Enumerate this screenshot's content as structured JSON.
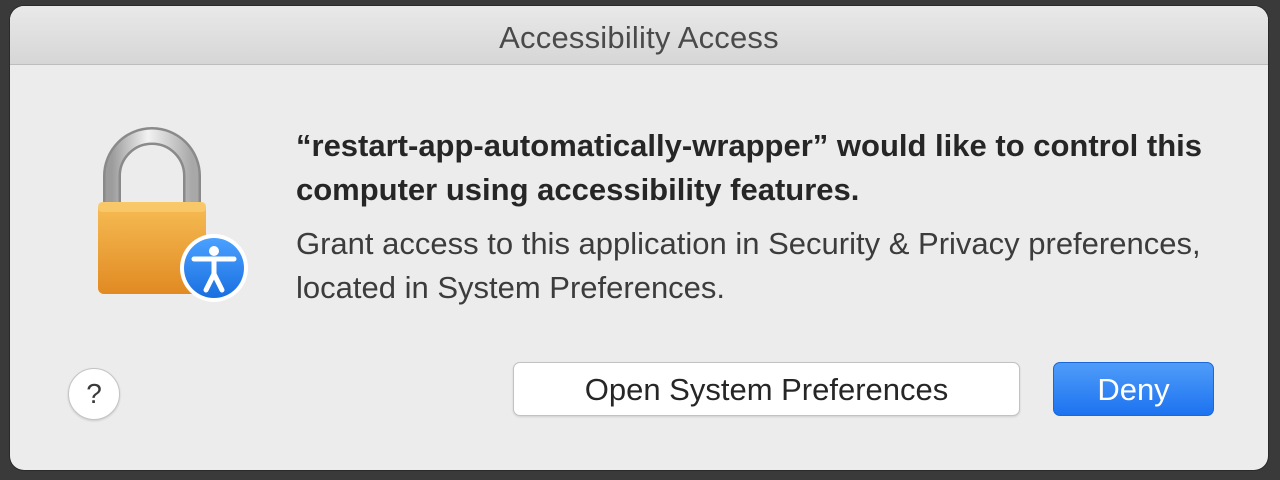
{
  "window": {
    "title": "Accessibility Access"
  },
  "message": {
    "headline": "“restart-app-automatically-wrapper” would like to control this computer using accessibility features.",
    "body": "Grant access to this application in Security & Privacy preferences, located in System Preferences."
  },
  "buttons": {
    "help_label": "?",
    "open_prefs_label": "Open System Preferences",
    "deny_label": "Deny"
  },
  "icons": {
    "main": "lock-icon",
    "badge": "accessibility-icon"
  },
  "colors": {
    "accent": "#1d73f0",
    "lock_body": "#f0a43a",
    "badge": "#2d86f0"
  }
}
